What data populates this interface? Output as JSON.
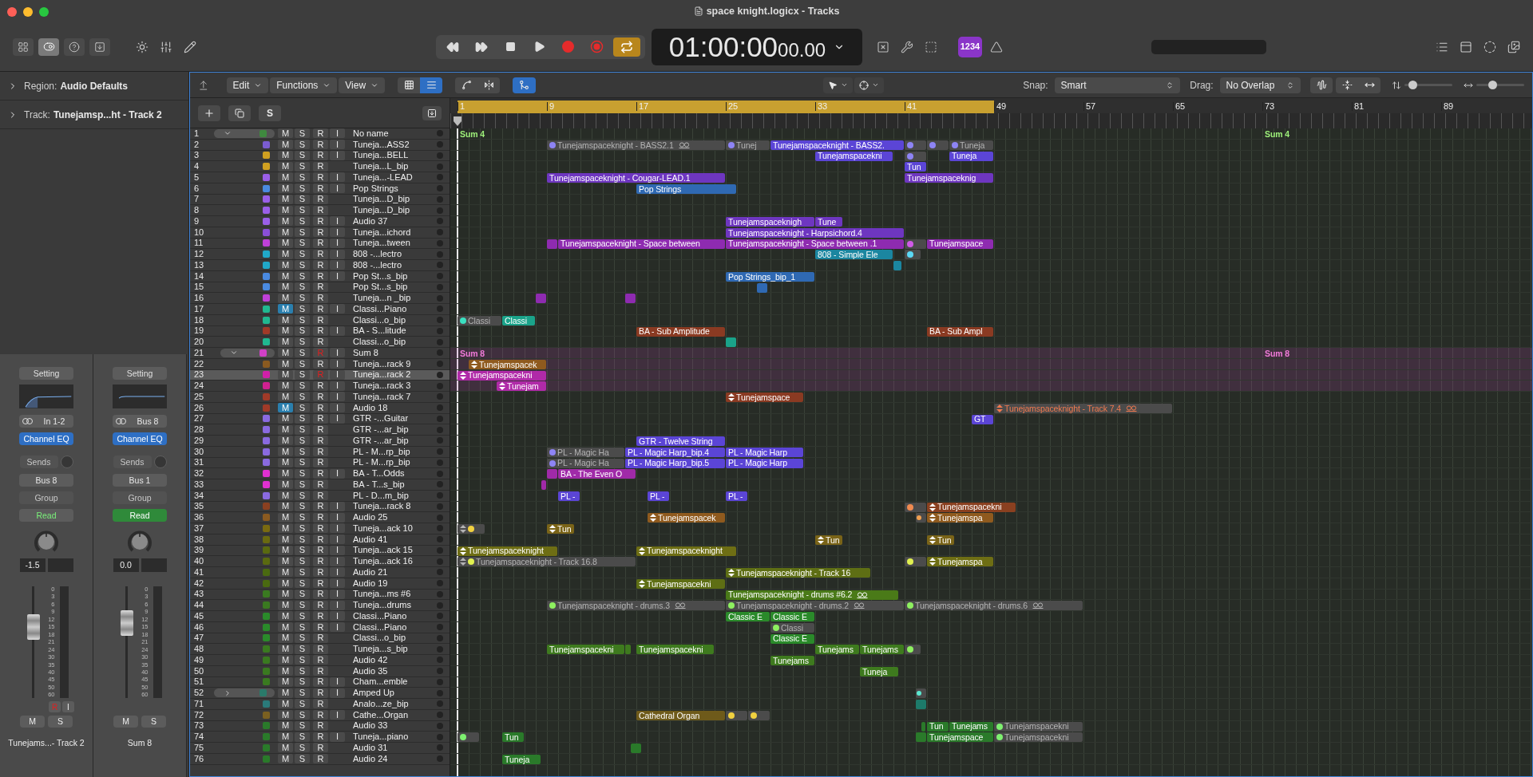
{
  "window": {
    "title": "space knight.logicx - Tracks"
  },
  "control_bar": {
    "inspector_shown": true,
    "lcd_main": "01:00:00",
    "lcd_sub": "00.00",
    "cycle_on": true,
    "count_in": "1234"
  },
  "inspector": {
    "region_label": "Region:",
    "region_value": "Audio Defaults",
    "track_label": "Track:",
    "track_value": "Tunejamsp...ht - Track 2"
  },
  "strips": [
    {
      "setting": "Setting",
      "input": "In 1-2",
      "insert": "Channel EQ",
      "sends": "Sends",
      "output": "Bus 8",
      "group": "Group",
      "automation": "Read",
      "automation_on": false,
      "volume": "-1.5",
      "level": 0.68,
      "scale": [
        "0",
        "3",
        "6",
        "9",
        "12",
        "15",
        "18",
        "21",
        "24",
        "30",
        "35",
        "40",
        "45",
        "50",
        "60"
      ],
      "rec_label": "R",
      "input_label": "I",
      "armed": true,
      "mute_label": "M",
      "solo_label": "S",
      "name": "Tunejams...- Track 2"
    },
    {
      "setting": "Setting",
      "input": "Bus 8",
      "insert": "Channel EQ",
      "sends": "Sends",
      "output": "Bus 1",
      "group": "Group",
      "automation": "Read",
      "automation_on": true,
      "volume": "0.0",
      "level": 0.72,
      "scale": [
        "0",
        "3",
        "6",
        "9",
        "12",
        "15",
        "18",
        "21",
        "24",
        "30",
        "35",
        "40",
        "45",
        "50",
        "60"
      ],
      "mute_label": "M",
      "solo_label": "S",
      "name": "Sum 8"
    }
  ],
  "toolbar": {
    "menus": [
      "Edit",
      "Functions",
      "View"
    ],
    "list_view": true,
    "catch_on": true,
    "snap_label": "Snap:",
    "snap_value": "Smart",
    "drag_label": "Drag:",
    "drag_value": "No Overlap",
    "zoom": [
      {
        "level": 0.1
      },
      {
        "level": 0.3
      }
    ]
  },
  "header": {
    "solo_button": "S"
  },
  "ruler": {
    "bars": [
      "1",
      "9",
      "17",
      "25",
      "33",
      "41",
      "49",
      "57",
      "65",
      "73",
      "81",
      "89"
    ],
    "cycle_on": true
  },
  "tracks": [
    {
      "number": "1",
      "name": "No name",
      "kind": "folder",
      "expanded": true,
      "color": "#3f8a3f",
      "mute_label": "M",
      "solo_label": "S",
      "rec_label": "R",
      "input_label": "I",
      "muted": false,
      "armed": false,
      "selected": false,
      "regions": [
        {
          "label": "Sum 4",
          "color": "#9ef07a",
          "kind": "folder-label",
          "take": false,
          "flex": false
        },
        {
          "label": "Sum 4",
          "color": "#9ef07a",
          "kind": "folder-label",
          "take": false,
          "flex": false
        }
      ],
      "children": [
        {
          "number": "2",
          "name": "Tuneja...ASS2",
          "kind": "track",
          "color": "#7a5cd0",
          "mute_label": "M",
          "solo_label": "S",
          "rec_label": "R",
          "input_label": "I",
          "muted": false,
          "armed": false,
          "selected": false,
          "regions": [
            {
              "label": "Tunejamspaceknight - BASS2.1",
              "color": "#8e84f5",
              "kind": "muted",
              "take": false,
              "flex": true
            },
            {
              "label": "Tunej",
              "color": "#8e84f5",
              "kind": "muted",
              "take": false,
              "flex": false
            },
            {
              "label": "Tunejamspaceknight - BASS2.",
              "color": "#5b45d6",
              "kind": "normal",
              "take": false,
              "flex": false
            },
            {
              "color": "#8e84f5",
              "kind": "muted",
              "take": false,
              "flex": false
            },
            {
              "color": "#8e84f5",
              "kind": "muted",
              "take": false,
              "flex": false
            },
            {
              "label": "Tuneja",
              "color": "#8e84f5",
              "kind": "muted",
              "take": false,
              "flex": false
            }
          ]
        },
        {
          "number": "3",
          "name": "Tuneja...BELL",
          "kind": "track",
          "color": "#d0a020",
          "mute_label": "M",
          "solo_label": "S",
          "rec_label": "R",
          "input_label": "I",
          "muted": false,
          "armed": false,
          "selected": false,
          "regions": [
            {
              "label": "Tunejamspacekni",
              "color": "#5b45d6",
              "kind": "normal",
              "take": false,
              "flex": false
            },
            {
              "color": "#8e84f5",
              "kind": "muted",
              "take": false,
              "flex": false
            },
            {
              "label": "Tuneja",
              "color": "#5b45d6",
              "kind": "normal",
              "take": false,
              "flex": false
            }
          ]
        },
        {
          "number": "4",
          "name": "Tuneja...L_bip",
          "kind": "track",
          "color": "#d0a020",
          "mute_label": "M",
          "solo_label": "S",
          "rec_label": "R",
          "muted": false,
          "armed": false,
          "selected": false,
          "regions": [
            {
              "label": "Tun",
              "color": "#5b45d6",
              "kind": "normal",
              "take": false,
              "flex": false
            }
          ]
        },
        {
          "number": "5",
          "name": "Tuneja...-LEAD",
          "kind": "track",
          "color": "#9a5fe8",
          "mute_label": "M",
          "solo_label": "S",
          "rec_label": "R",
          "input_label": "I",
          "muted": false,
          "armed": false,
          "selected": false,
          "regions": [
            {
              "label": "Tunejamspaceknight - Cougar-LEAD.1",
              "color": "#6e36c0",
              "kind": "normal",
              "take": false,
              "flex": false
            },
            {
              "label": "Tunejamspaceknig",
              "color": "#6e36c0",
              "kind": "normal",
              "take": false,
              "flex": false
            }
          ]
        },
        {
          "number": "6",
          "name": "Pop Strings",
          "kind": "track",
          "color": "#4a8ae0",
          "mute_label": "M",
          "solo_label": "S",
          "rec_label": "R",
          "input_label": "I",
          "muted": false,
          "armed": false,
          "selected": false,
          "regions": [
            {
              "label": "Pop Strings",
              "color": "#2f69b3",
              "kind": "normal",
              "take": false,
              "flex": false
            }
          ]
        },
        {
          "number": "7",
          "name": "Tuneja...D_bip",
          "kind": "track",
          "color": "#9a5fe8",
          "mute_label": "M",
          "solo_label": "S",
          "rec_label": "R",
          "muted": false,
          "armed": false,
          "selected": false
        },
        {
          "number": "8",
          "name": "Tuneja...D_bip",
          "kind": "track",
          "color": "#9a5fe8",
          "mute_label": "M",
          "solo_label": "S",
          "rec_label": "R",
          "muted": false,
          "armed": false,
          "selected": false
        },
        {
          "number": "9",
          "name": "Audio 37",
          "kind": "track",
          "color": "#9a5fe8",
          "mute_label": "M",
          "solo_label": "S",
          "rec_label": "R",
          "input_label": "I",
          "muted": false,
          "armed": false,
          "selected": false,
          "regions": [
            {
              "label": "Tunejamspaceknigh",
              "color": "#6e36c0",
              "kind": "normal",
              "take": false,
              "flex": false
            },
            {
              "label": "Tune",
              "color": "#6e36c0",
              "kind": "normal",
              "take": false,
              "flex": false
            }
          ]
        },
        {
          "number": "10",
          "name": "Tuneja...ichord",
          "kind": "track",
          "color": "#8a4fd8",
          "mute_label": "M",
          "solo_label": "S",
          "rec_label": "R",
          "input_label": "I",
          "muted": false,
          "armed": false,
          "selected": false,
          "regions": [
            {
              "label": "Tunejamspaceknight - Harpsichord.4",
              "color": "#6e36c0",
              "kind": "normal",
              "take": false,
              "flex": false
            }
          ]
        },
        {
          "number": "11",
          "name": "Tuneja...tween",
          "kind": "track",
          "color": "#c040d8",
          "mute_label": "M",
          "solo_label": "S",
          "rec_label": "R",
          "input_label": "I",
          "muted": false,
          "armed": false,
          "selected": false,
          "regions": [
            {
              "color": "#8e2bb0",
              "kind": "normal",
              "take": false,
              "flex": false
            },
            {
              "label": "Tunejamspaceknight - Space between",
              "color": "#8e2bb0",
              "kind": "normal",
              "take": false,
              "flex": false
            },
            {
              "label": "Tunejamspaceknight - Space between .1",
              "color": "#8e2bb0",
              "kind": "normal",
              "take": false,
              "flex": false
            },
            {
              "color": "#d05ae8",
              "kind": "muted",
              "take": false,
              "flex": false
            },
            {
              "label": "Tunejamspace",
              "color": "#8e2bb0",
              "kind": "normal",
              "take": false,
              "flex": false
            }
          ]
        },
        {
          "number": "12",
          "name": "808 -...lectro",
          "kind": "track",
          "color": "#20a8c8",
          "mute_label": "M",
          "solo_label": "S",
          "rec_label": "R",
          "input_label": "I",
          "muted": false,
          "armed": false,
          "selected": false,
          "regions": [
            {
              "label": "808 - Simple Ele",
              "color": "#1b86a0",
              "kind": "normal",
              "take": false,
              "flex": false
            },
            {
              "color": "#5bd8f5",
              "kind": "muted",
              "take": false,
              "flex": false
            }
          ]
        },
        {
          "number": "13",
          "name": "808 -...lectro",
          "kind": "track",
          "color": "#20a8c8",
          "mute_label": "M",
          "solo_label": "S",
          "rec_label": "R",
          "input_label": "I",
          "muted": false,
          "armed": false,
          "selected": false,
          "regions": [
            {
              "color": "#1b86a0",
              "kind": "normal",
              "take": false,
              "flex": false
            }
          ]
        },
        {
          "number": "14",
          "name": "Pop St...s_bip",
          "kind": "track",
          "color": "#4a8ae0",
          "mute_label": "M",
          "solo_label": "S",
          "rec_label": "R",
          "input_label": "I",
          "muted": false,
          "armed": false,
          "selected": false,
          "regions": [
            {
              "label": "Pop Strings_bip_1",
              "color": "#2f69b3",
              "kind": "normal",
              "take": false,
              "flex": false
            }
          ]
        },
        {
          "number": "15",
          "name": "Pop St...s_bip",
          "kind": "track",
          "color": "#4a8ae0",
          "mute_label": "M",
          "solo_label": "S",
          "rec_label": "R",
          "muted": false,
          "armed": false,
          "selected": false,
          "regions": [
            {
              "color": "#2f69b3",
              "kind": "normal",
              "take": false,
              "flex": false
            }
          ]
        },
        {
          "number": "16",
          "name": "Tuneja...n _bip",
          "kind": "track",
          "color": "#c040d8",
          "mute_label": "M",
          "solo_label": "S",
          "rec_label": "R",
          "muted": false,
          "armed": false,
          "selected": false,
          "regions": [
            {
              "color": "#8e2bb0",
              "kind": "normal",
              "take": false,
              "flex": false
            },
            {
              "color": "#8e2bb0",
              "kind": "normal",
              "take": false,
              "flex": false
            }
          ]
        },
        {
          "number": "17",
          "name": "Classi...Piano",
          "kind": "track",
          "color": "#20b890",
          "mute_label": "M",
          "solo_label": "S",
          "rec_label": "R",
          "input_label": "I",
          "muted": true,
          "armed": false,
          "selected": false
        },
        {
          "number": "18",
          "name": "Classi...o_bip",
          "kind": "track",
          "color": "#20b890",
          "mute_label": "M",
          "solo_label": "S",
          "rec_label": "R",
          "muted": false,
          "armed": false,
          "selected": false,
          "regions": [
            {
              "label": "Classi",
              "color": "#3ae0c0",
              "kind": "muted",
              "take": false,
              "flex": false
            },
            {
              "label": "Classi",
              "color": "#1aa38a",
              "kind": "normal",
              "take": false,
              "flex": false
            }
          ]
        },
        {
          "number": "19",
          "name": "BA - S...litude",
          "kind": "track",
          "color": "#a03a28",
          "mute_label": "M",
          "solo_label": "S",
          "rec_label": "R",
          "input_label": "I",
          "muted": false,
          "armed": false,
          "selected": false,
          "regions": [
            {
              "label": "BA - Sub Amplitude",
              "color": "#8a3a22",
              "kind": "normal",
              "take": false,
              "flex": false
            },
            {
              "label": "BA - Sub Ampl",
              "color": "#8a3a22",
              "kind": "normal",
              "take": false,
              "flex": false
            }
          ]
        },
        {
          "number": "20",
          "name": "Classi...o_bip",
          "kind": "track",
          "color": "#20b890",
          "mute_label": "M",
          "solo_label": "S",
          "rec_label": "R",
          "muted": false,
          "armed": false,
          "selected": false,
          "regions": [
            {
              "color": "#1aa38a",
              "kind": "normal",
              "take": false,
              "flex": false
            }
          ]
        },
        {
          "number": "21",
          "name": "Sum 8",
          "kind": "folder",
          "expanded": true,
          "color": "#d040c8",
          "mute_label": "M",
          "solo_label": "S",
          "rec_label": "R",
          "input_label": "I",
          "muted": false,
          "armed": true,
          "selected": false,
          "regions": [
            {
              "label": "Sum 8",
              "color": "#f07ad8",
              "kind": "folder-label",
              "take": false,
              "flex": false
            },
            {
              "label": "Sum 8",
              "color": "#f07ad8",
              "kind": "folder-label",
              "take": false,
              "flex": false
            }
          ],
          "children": [
            {
              "number": "22",
              "name": "Tuneja...rack 9",
              "kind": "track",
              "color": "#8a5a20",
              "mute_label": "M",
              "solo_label": "S",
              "rec_label": "R",
              "input_label": "I",
              "muted": false,
              "armed": false,
              "selected": false,
              "regions": [
                {
                  "label": "Tunejamspacek",
                  "color": "#8f5a1e",
                  "kind": "normal",
                  "take": true,
                  "flex": false
                }
              ]
            },
            {
              "number": "23",
              "name": "Tuneja...rack 2",
              "kind": "track",
              "color": "#d020a8",
              "mute_label": "M",
              "solo_label": "S",
              "rec_label": "R",
              "input_label": "I",
              "muted": false,
              "armed": true,
              "selected": true,
              "regions": [
                {
                  "label": "Tunejamspacekni",
                  "color": "#b02aa8",
                  "kind": "normal",
                  "take": true,
                  "flex": false
                }
              ]
            },
            {
              "number": "24",
              "name": "Tuneja...rack 3",
              "kind": "track",
              "color": "#d02090",
              "mute_label": "M",
              "solo_label": "S",
              "rec_label": "R",
              "input_label": "I",
              "muted": false,
              "armed": false,
              "selected": false,
              "regions": [
                {
                  "label": "Tunejam",
                  "color": "#b02aa8",
                  "kind": "normal",
                  "take": true,
                  "flex": false
                }
              ]
            }
          ]
        },
        {
          "number": "25",
          "name": "Tuneja...rack 7",
          "kind": "track",
          "color": "#a03a28",
          "mute_label": "M",
          "solo_label": "S",
          "rec_label": "R",
          "input_label": "I",
          "muted": false,
          "armed": false,
          "selected": false,
          "regions": [
            {
              "label": "Tunejamspace",
              "color": "#8a3a22",
              "kind": "normal",
              "take": true,
              "flex": false
            }
          ]
        }
      ]
    },
    {
      "number": "26",
      "name": "Audio 18",
      "kind": "track",
      "color": "#a03a28",
      "mute_label": "M",
      "solo_label": "S",
      "rec_label": "R",
      "input_label": "I",
      "muted": true,
      "armed": false,
      "selected": false,
      "regions": [
        {
          "label": "Tunejamspaceknight - Track 7.4",
          "color": "#f07a50",
          "kind": "tinted",
          "take": true,
          "flex": true
        }
      ]
    },
    {
      "number": "27",
      "name": "GTR -...Guitar",
      "kind": "track",
      "color": "#8a6ae0",
      "mute_label": "M",
      "solo_label": "S",
      "rec_label": "R",
      "input_label": "I",
      "muted": false,
      "armed": false,
      "selected": false,
      "regions": [
        {
          "label": "GT",
          "color": "#5b45d6",
          "kind": "normal",
          "take": false,
          "flex": false
        }
      ]
    },
    {
      "number": "28",
      "name": "GTR -...ar_bip",
      "kind": "track",
      "color": "#8a6ae0",
      "mute_label": "M",
      "solo_label": "S",
      "rec_label": "R",
      "muted": false,
      "armed": false,
      "selected": false
    },
    {
      "number": "29",
      "name": "GTR -...ar_bip",
      "kind": "track",
      "color": "#8a6ae0",
      "mute_label": "M",
      "solo_label": "S",
      "rec_label": "R",
      "muted": false,
      "armed": false,
      "selected": false,
      "regions": [
        {
          "label": "GTR - Twelve String",
          "color": "#5b45d6",
          "kind": "normal",
          "take": false,
          "flex": false
        }
      ]
    },
    {
      "number": "30",
      "name": "PL - M...rp_bip",
      "kind": "track",
      "color": "#8a6ae0",
      "mute_label": "M",
      "solo_label": "S",
      "rec_label": "R",
      "muted": false,
      "armed": false,
      "selected": false,
      "regions": [
        {
          "label": "PL - Magic Ha",
          "color": "#8e84f5",
          "kind": "muted",
          "take": false,
          "flex": false
        },
        {
          "label": "PL - Magic Harp_bip.4",
          "color": "#5b45d6",
          "kind": "normal",
          "take": false,
          "flex": false
        },
        {
          "label": "PL - Magic Harp",
          "color": "#5b45d6",
          "kind": "normal",
          "take": false,
          "flex": false
        }
      ]
    },
    {
      "number": "31",
      "name": "PL - M...rp_bip",
      "kind": "track",
      "color": "#8a6ae0",
      "mute_label": "M",
      "solo_label": "S",
      "rec_label": "R",
      "muted": false,
      "armed": false,
      "selected": false,
      "regions": [
        {
          "label": "PL - Magic Ha",
          "color": "#8e84f5",
          "kind": "muted",
          "take": false,
          "flex": false
        },
        {
          "label": "PL - Magic Harp_bip.5",
          "color": "#5b45d6",
          "kind": "normal",
          "take": false,
          "flex": false
        },
        {
          "label": "PL - Magic Harp",
          "color": "#5b45d6",
          "kind": "normal",
          "take": false,
          "flex": false
        }
      ]
    },
    {
      "number": "32",
      "name": "BA - T...Odds",
      "kind": "track",
      "color": "#e030d0",
      "mute_label": "M",
      "solo_label": "S",
      "rec_label": "R",
      "input_label": "I",
      "muted": false,
      "armed": false,
      "selected": false,
      "regions": [
        {
          "color": "#a02aa8",
          "kind": "normal",
          "take": false,
          "flex": false
        },
        {
          "label": "BA - The Even O",
          "color": "#a02aa8",
          "kind": "normal",
          "take": false,
          "flex": false
        }
      ]
    },
    {
      "number": "33",
      "name": "BA - T...s_bip",
      "kind": "track",
      "color": "#e030d0",
      "mute_label": "M",
      "solo_label": "S",
      "rec_label": "R",
      "muted": false,
      "armed": false,
      "selected": false,
      "regions": [
        {
          "color": "#a02aa8",
          "kind": "normal",
          "take": false,
          "flex": false
        }
      ]
    },
    {
      "number": "34",
      "name": "PL - D...m_bip",
      "kind": "track",
      "color": "#8a6ae0",
      "mute_label": "M",
      "solo_label": "S",
      "rec_label": "R",
      "muted": false,
      "armed": false,
      "selected": false,
      "regions": [
        {
          "label": "PL -",
          "color": "#5b45d6",
          "kind": "normal",
          "take": false,
          "flex": false
        },
        {
          "label": "PL -",
          "color": "#5b45d6",
          "kind": "normal",
          "take": false,
          "flex": false
        },
        {
          "label": "PL -",
          "color": "#5b45d6",
          "kind": "normal",
          "take": false,
          "flex": false
        }
      ]
    },
    {
      "number": "35",
      "name": "Tuneja...rack 8",
      "kind": "track",
      "color": "#8a4020",
      "mute_label": "M",
      "solo_label": "S",
      "rec_label": "R",
      "input_label": "I",
      "muted": false,
      "armed": false,
      "selected": false,
      "regions": [
        {
          "color": "#f08a50",
          "kind": "muted",
          "take": false,
          "flex": false
        },
        {
          "label": "Tunejamspacekni",
          "color": "#8a4020",
          "kind": "normal",
          "take": true,
          "flex": false
        }
      ]
    },
    {
      "number": "36",
      "name": "Audio 25",
      "kind": "track",
      "color": "#8a5a20",
      "mute_label": "M",
      "solo_label": "S",
      "rec_label": "R",
      "input_label": "I",
      "muted": false,
      "armed": false,
      "selected": false,
      "regions": [
        {
          "label": "Tunejamspacek",
          "color": "#8f5a1e",
          "kind": "normal",
          "take": true,
          "flex": false
        },
        {
          "color": "#f0a050",
          "kind": "muted",
          "take": false,
          "flex": false
        },
        {
          "label": "Tunejamspa",
          "color": "#8f5a1e",
          "kind": "normal",
          "take": true,
          "flex": false
        }
      ]
    },
    {
      "number": "37",
      "name": "Tuneja...ack 10",
      "kind": "track",
      "color": "#7a6a10",
      "mute_label": "M",
      "solo_label": "S",
      "rec_label": "R",
      "input_label": "I",
      "muted": false,
      "armed": false,
      "selected": false,
      "regions": [
        {
          "color": "#f0d040",
          "kind": "muted",
          "take": true,
          "flex": false
        },
        {
          "label": "Tun",
          "color": "#7a6418",
          "kind": "normal",
          "take": true,
          "flex": false
        }
      ]
    },
    {
      "number": "38",
      "name": "Audio 41",
      "kind": "track",
      "color": "#6a6a10",
      "mute_label": "M",
      "solo_label": "S",
      "rec_label": "R",
      "input_label": "I",
      "muted": false,
      "armed": false,
      "selected": false,
      "regions": [
        {
          "label": "Tun",
          "color": "#7a6418",
          "kind": "normal",
          "take": true,
          "flex": false
        },
        {
          "label": "Tun",
          "color": "#7a6418",
          "kind": "normal",
          "take": true,
          "flex": false
        }
      ]
    },
    {
      "number": "39",
      "name": "Tuneja...ack 15",
      "kind": "track",
      "color": "#5a6a10",
      "mute_label": "M",
      "solo_label": "S",
      "rec_label": "R",
      "input_label": "I",
      "muted": false,
      "armed": false,
      "selected": false,
      "regions": [
        {
          "label": "Tunejamspaceknight",
          "color": "#6e6e14",
          "kind": "normal",
          "take": true,
          "flex": false
        },
        {
          "label": "Tunejamspaceknight",
          "color": "#6e6e14",
          "kind": "normal",
          "take": true,
          "flex": false
        }
      ]
    },
    {
      "number": "40",
      "name": "Tuneja...ack 16",
      "kind": "track",
      "color": "#5a6a10",
      "mute_label": "M",
      "solo_label": "S",
      "rec_label": "R",
      "input_label": "I",
      "muted": false,
      "armed": false,
      "selected": false,
      "regions": [
        {
          "label": "Tunejamspaceknight - Track 16.8",
          "color": "#e0f050",
          "kind": "muted",
          "take": true,
          "flex": false
        },
        {
          "color": "#e0f050",
          "kind": "muted",
          "take": false,
          "flex": false
        },
        {
          "label": "Tunejamspa",
          "color": "#6e6e14",
          "kind": "normal",
          "take": true,
          "flex": false
        }
      ]
    },
    {
      "number": "41",
      "name": "Audio 21",
      "kind": "track",
      "color": "#4a6a10",
      "mute_label": "M",
      "solo_label": "S",
      "rec_label": "R",
      "input_label": "I",
      "muted": false,
      "armed": false,
      "selected": false,
      "regions": [
        {
          "label": "Tunejamspaceknight - Track 16",
          "color": "#5e6e14",
          "kind": "normal",
          "take": true,
          "flex": false
        }
      ]
    },
    {
      "number": "42",
      "name": "Audio 19",
      "kind": "track",
      "color": "#4a6a10",
      "mute_label": "M",
      "solo_label": "S",
      "rec_label": "R",
      "input_label": "I",
      "muted": false,
      "armed": false,
      "selected": false,
      "regions": [
        {
          "label": "Tunejamspacekni",
          "color": "#5e6e14",
          "kind": "normal",
          "take": true,
          "flex": false
        }
      ]
    },
    {
      "number": "43",
      "name": "Tuneja...ms #6",
      "kind": "track",
      "color": "#3a7a20",
      "mute_label": "M",
      "solo_label": "S",
      "rec_label": "R",
      "input_label": "I",
      "muted": false,
      "armed": false,
      "selected": false,
      "regions": [
        {
          "label": "Tunejamspaceknight - drums #6.2",
          "color": "#4a7a18",
          "kind": "normal",
          "take": false,
          "flex": true
        }
      ]
    },
    {
      "number": "44",
      "name": "Tuneja...drums",
      "kind": "track",
      "color": "#3a7a20",
      "mute_label": "M",
      "solo_label": "S",
      "rec_label": "R",
      "input_label": "I",
      "muted": false,
      "armed": false,
      "selected": false,
      "regions": [
        {
          "label": "Tunejamspaceknight - drums.3",
          "color": "#8ef060",
          "kind": "muted",
          "take": false,
          "flex": true
        },
        {
          "label": "Tunejamspaceknight - drums.2",
          "color": "#8ef060",
          "kind": "muted",
          "take": false,
          "flex": true
        },
        {
          "label": "Tunejamspaceknight - drums.6",
          "color": "#8ef060",
          "kind": "muted",
          "take": false,
          "flex": true
        }
      ]
    },
    {
      "number": "45",
      "name": "Classi...Piano",
      "kind": "track",
      "color": "#2a8a2a",
      "mute_label": "M",
      "solo_label": "S",
      "rec_label": "R",
      "input_label": "I",
      "muted": false,
      "armed": false,
      "selected": false,
      "regions": [
        {
          "label": "Classic E",
          "color": "#2a8a2a",
          "kind": "normal",
          "take": false,
          "flex": false
        },
        {
          "label": "Classic E",
          "color": "#2a8a2a",
          "kind": "normal",
          "take": false,
          "flex": false
        }
      ]
    },
    {
      "number": "46",
      "name": "Classi...Piano",
      "kind": "track",
      "color": "#2a8a2a",
      "mute_label": "M",
      "solo_label": "S",
      "rec_label": "R",
      "input_label": "I",
      "muted": false,
      "armed": false,
      "selected": false,
      "regions": [
        {
          "label": "Classi",
          "color": "#8ef060",
          "kind": "muted",
          "take": false,
          "flex": false
        }
      ]
    },
    {
      "number": "47",
      "name": "Classi...o_bip",
      "kind": "track",
      "color": "#2a8a2a",
      "mute_label": "M",
      "solo_label": "S",
      "rec_label": "R",
      "muted": false,
      "armed": false,
      "selected": false,
      "regions": [
        {
          "label": "Classic E",
          "color": "#2a8a2a",
          "kind": "normal",
          "take": false,
          "flex": false
        }
      ]
    },
    {
      "number": "48",
      "name": "Tuneja...s_bip",
      "kind": "track",
      "color": "#3a7a20",
      "mute_label": "M",
      "solo_label": "S",
      "rec_label": "R",
      "muted": false,
      "armed": false,
      "selected": false,
      "regions": [
        {
          "label": "Tunejamspacekni",
          "color": "#3e7a1e",
          "kind": "normal",
          "take": false,
          "flex": false
        },
        {
          "color": "#3e7a1e",
          "kind": "normal",
          "take": false,
          "flex": false
        },
        {
          "label": "Tunejamspacekni",
          "color": "#3e7a1e",
          "kind": "normal",
          "take": false,
          "flex": false
        },
        {
          "label": "Tunejams",
          "color": "#3e7a1e",
          "kind": "normal",
          "take": false,
          "flex": false
        },
        {
          "label": "Tunejams",
          "color": "#3e7a1e",
          "kind": "normal",
          "take": false,
          "flex": false
        },
        {
          "color": "#8ef060",
          "kind": "muted",
          "take": false,
          "flex": false
        }
      ]
    },
    {
      "number": "49",
      "name": "Audio 42",
      "kind": "track",
      "color": "#3a7a20",
      "mute_label": "M",
      "solo_label": "S",
      "rec_label": "R",
      "muted": false,
      "armed": false,
      "selected": false,
      "regions": [
        {
          "label": "Tunejams",
          "color": "#3e7a1e",
          "kind": "normal",
          "take": false,
          "flex": false
        }
      ]
    },
    {
      "number": "50",
      "name": "Audio 35",
      "kind": "track",
      "color": "#3a7a20",
      "mute_label": "M",
      "solo_label": "S",
      "rec_label": "R",
      "muted": false,
      "armed": false,
      "selected": false,
      "regions": [
        {
          "label": "Tuneja",
          "color": "#3e7a1e",
          "kind": "normal",
          "take": false,
          "flex": false
        }
      ]
    },
    {
      "number": "51",
      "name": "Cham...emble",
      "kind": "track",
      "color": "#3a7a20",
      "mute_label": "M",
      "solo_label": "S",
      "rec_label": "R",
      "input_label": "I",
      "muted": false,
      "armed": false,
      "selected": false
    },
    {
      "number": "52",
      "name": "Amped Up",
      "kind": "folder",
      "expanded": false,
      "color": "#2a7a6a",
      "mute_label": "M",
      "solo_label": "S",
      "rec_label": "R",
      "input_label": "I",
      "muted": false,
      "armed": false,
      "selected": false,
      "regions": [
        {
          "color": "#5be8d0",
          "kind": "muted",
          "take": false,
          "flex": false
        }
      ]
    },
    {
      "number": "71",
      "name": "Analo...ze_bip",
      "kind": "track",
      "color": "#2a7a7a",
      "mute_label": "M",
      "solo_label": "S",
      "rec_label": "R",
      "muted": false,
      "armed": false,
      "selected": false,
      "regions": [
        {
          "color": "#1d7a6a",
          "kind": "normal",
          "take": false,
          "flex": false
        }
      ]
    },
    {
      "number": "72",
      "name": "Cathe...Organ",
      "kind": "track",
      "color": "#7a6020",
      "mute_label": "M",
      "solo_label": "S",
      "rec_label": "R",
      "input_label": "I",
      "muted": false,
      "armed": false,
      "selected": false,
      "regions": [
        {
          "label": "Cathedral Organ",
          "color": "#6e5a1a",
          "kind": "normal",
          "take": false,
          "flex": false
        },
        {
          "color": "#f0d040",
          "kind": "muted",
          "take": false,
          "flex": false
        },
        {
          "color": "#f0d040",
          "kind": "muted",
          "take": false,
          "flex": false
        }
      ]
    },
    {
      "number": "73",
      "name": "Audio 33",
      "kind": "track",
      "color": "#2a7a2a",
      "mute_label": "M",
      "solo_label": "S",
      "rec_label": "R",
      "muted": false,
      "armed": false,
      "selected": false,
      "regions": [
        {
          "color": "#2a7a2a",
          "kind": "normal",
          "take": false,
          "flex": false
        },
        {
          "label": "Tun",
          "color": "#2a7a2a",
          "kind": "normal",
          "take": false,
          "flex": false
        },
        {
          "label": "Tunejams",
          "color": "#2a7a2a",
          "kind": "normal",
          "take": false,
          "flex": false
        },
        {
          "label": "Tunejamspacekni",
          "color": "#7ef070",
          "kind": "muted",
          "take": false,
          "flex": false
        }
      ]
    },
    {
      "number": "74",
      "name": "Tuneja...piano",
      "kind": "track",
      "color": "#2a7a2a",
      "mute_label": "M",
      "solo_label": "S",
      "rec_label": "R",
      "input_label": "I",
      "muted": false,
      "armed": false,
      "selected": false,
      "regions": [
        {
          "color": "#7ef070",
          "kind": "muted",
          "take": false,
          "flex": false
        },
        {
          "label": "Tun",
          "color": "#2a7a2a",
          "kind": "normal",
          "take": false,
          "flex": false
        },
        {
          "color": "#2a7a2a",
          "kind": "normal",
          "take": false,
          "flex": false
        },
        {
          "label": "Tunejamspace",
          "color": "#2a7a2a",
          "kind": "normal",
          "take": false,
          "flex": false
        },
        {
          "label": "Tunejamspacekni",
          "color": "#7ef070",
          "kind": "muted",
          "take": false,
          "flex": false
        }
      ]
    },
    {
      "number": "75",
      "name": "Audio 31",
      "kind": "track",
      "color": "#2a7a2a",
      "mute_label": "M",
      "solo_label": "S",
      "rec_label": "R",
      "muted": false,
      "armed": false,
      "selected": false,
      "regions": [
        {
          "color": "#2a7a2a",
          "kind": "normal",
          "take": false,
          "flex": false
        }
      ]
    },
    {
      "number": "76",
      "name": "Audio 24",
      "kind": "track",
      "color": "#2a7a2a",
      "mute_label": "M",
      "solo_label": "S",
      "rec_label": "R",
      "muted": false,
      "armed": false,
      "selected": false,
      "regions": [
        {
          "label": "Tuneja",
          "color": "#2a7a2a",
          "kind": "normal",
          "take": false,
          "flex": false
        }
      ]
    }
  ]
}
